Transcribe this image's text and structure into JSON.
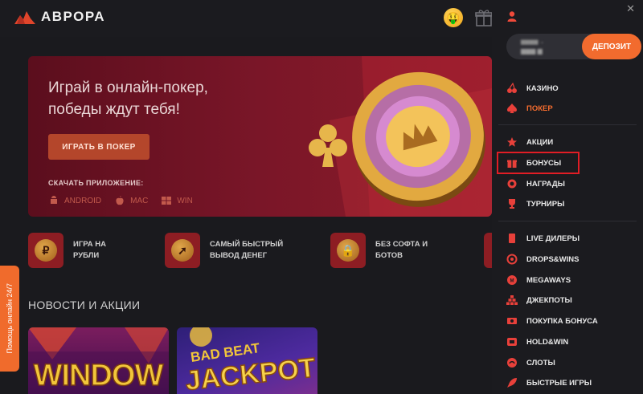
{
  "brand": {
    "name": "АВРОРА",
    "accent": "#f26b2e"
  },
  "hero": {
    "title_line1": "Играй в онлайн-покер,",
    "title_line2": "победы ждут тебя!",
    "cta": "ИГРАТЬ В ПОКЕР",
    "download_label": "СКАЧАТЬ ПРИЛОЖЕНИЕ:",
    "platforms": [
      "ANDROID",
      "MAC",
      "WIN"
    ]
  },
  "features": [
    {
      "line1": "ИГРА НА",
      "line2": "РУБЛИ",
      "icon": "ruble-icon"
    },
    {
      "line1": "САМЫЙ БЫСТРЫЙ",
      "line2": "ВЫВОД ДЕНЕГ",
      "icon": "rocket-icon"
    },
    {
      "line1": "БЕЗ СОФТА И",
      "line2": "БОТОВ",
      "icon": "lock-icon"
    }
  ],
  "news": {
    "title": "НОВОСТИ И АКЦИИ"
  },
  "help": {
    "label": "Помощь онлайн 24/7"
  },
  "panel": {
    "deposit": "ДЕПОЗИТ",
    "menu": [
      {
        "label": "КАЗИНО",
        "icon": "cherry-icon"
      },
      {
        "label": "ПОКЕР",
        "icon": "spade-icon",
        "active": true
      },
      {
        "label": "АКЦИИ",
        "icon": "star-icon"
      },
      {
        "label": "БОНУСЫ",
        "icon": "gift-icon"
      },
      {
        "label": "НАГРАДЫ",
        "icon": "medal-icon"
      },
      {
        "label": "ТУРНИРЫ",
        "icon": "trophy-icon"
      },
      {
        "label": "LIVE ДИЛЕРЫ",
        "icon": "cards-icon"
      },
      {
        "label": "DROPS&WINS",
        "icon": "drops-icon"
      },
      {
        "label": "MEGAWAYS",
        "icon": "megaways-icon"
      },
      {
        "label": "ДЖЕКПОТЫ",
        "icon": "pyramid-icon"
      },
      {
        "label": "ПОКУПКА БОНУСА",
        "icon": "bonus-buy-icon"
      },
      {
        "label": "HOLD&WIN",
        "icon": "hold-win-icon"
      },
      {
        "label": "СЛОТЫ",
        "icon": "slots-icon"
      },
      {
        "label": "БЫСТРЫЕ ИГРЫ",
        "icon": "rocket-small-icon"
      }
    ]
  }
}
